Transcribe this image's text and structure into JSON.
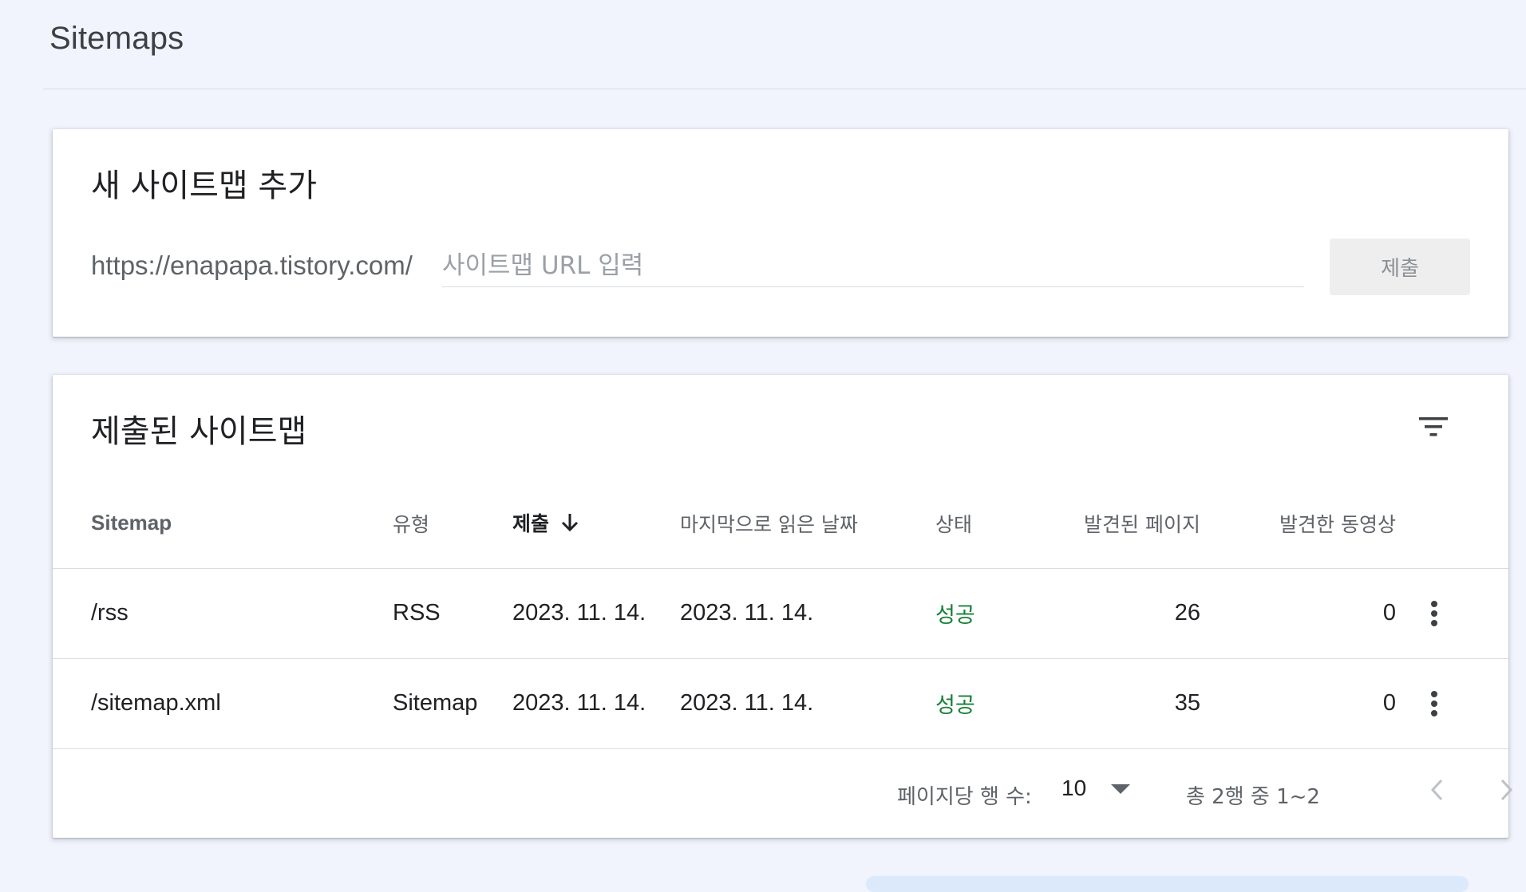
{
  "page": {
    "title": "Sitemaps"
  },
  "add_sitemap": {
    "title": "새 사이트맵 추가",
    "url_prefix": "https://enapapa.tistory.com/",
    "input_placeholder": "사이트맵 URL 입력",
    "input_value": "",
    "submit_label": "제출"
  },
  "submitted": {
    "title": "제출된 사이트맵",
    "columns": {
      "sitemap": "Sitemap",
      "type": "유형",
      "submitted": "제출",
      "last_read": "마지막으로 읽은 날짜",
      "status": "상태",
      "pages": "발견된 페이지",
      "videos": "발견한 동영상"
    },
    "sort": {
      "column": "submitted",
      "direction": "descending"
    },
    "rows": [
      {
        "sitemap": "/rss",
        "type": "RSS",
        "submitted": "2023. 11. 14.",
        "last_read": "2023. 11. 14.",
        "status": "성공",
        "pages": "26",
        "videos": "0"
      },
      {
        "sitemap": "/sitemap.xml",
        "type": "Sitemap",
        "submitted": "2023. 11. 14.",
        "last_read": "2023. 11. 14.",
        "status": "성공",
        "pages": "35",
        "videos": "0"
      }
    ],
    "pagination": {
      "rows_per_page_label": "페이지당 행 수:",
      "rows_per_page": "10",
      "range": "총 2행 중 1~2"
    }
  },
  "colors": {
    "background": "#f1f4fd",
    "status_success": "#188038",
    "button_disabled": "#eeeeee"
  },
  "icons": [
    "filter-icon",
    "arrow-down-icon",
    "more-vert-icon",
    "dropdown-arrow-icon",
    "chevron-left-icon",
    "chevron-right-icon"
  ]
}
